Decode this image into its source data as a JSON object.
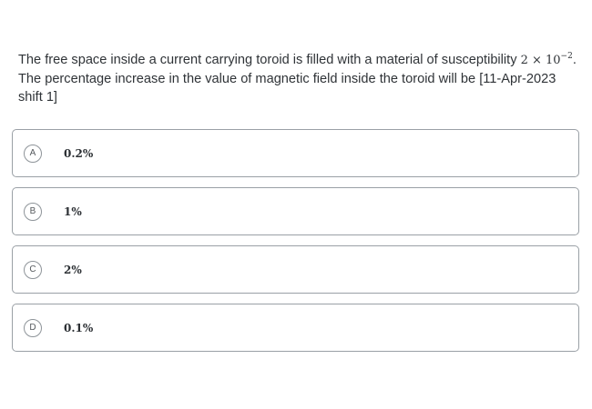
{
  "question": {
    "text_before": "The free space inside a current carrying toroid is filled with a material of susceptibility ",
    "math_base": "2 × 10",
    "math_exponent": "−2",
    "text_after": ". The percentage increase in the value of magnetic field inside the toroid will be [11-Apr-2023 shift 1]"
  },
  "options": [
    {
      "letter": "A",
      "text": "0.2%"
    },
    {
      "letter": "B",
      "text": "1%"
    },
    {
      "letter": "C",
      "text": "2%"
    },
    {
      "letter": "D",
      "text": "0.1%"
    }
  ]
}
